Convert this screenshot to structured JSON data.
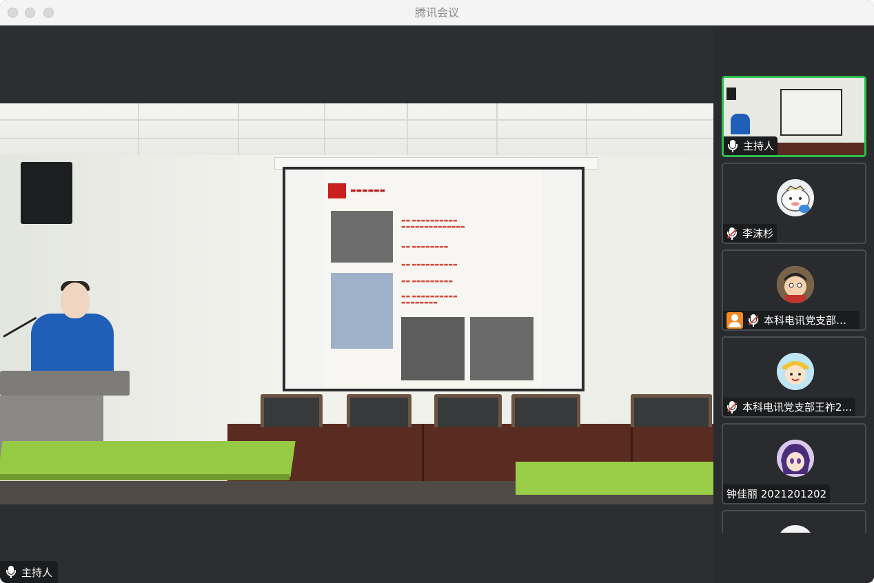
{
  "window": {
    "title": "腾讯会议"
  },
  "main_video": {
    "speaker_label": "主持人"
  },
  "participants": [
    {
      "name": "主持人",
      "muted": false,
      "host": false,
      "type": "camera"
    },
    {
      "name": "李沫杉",
      "muted": true,
      "host": false,
      "type": "avatar"
    },
    {
      "name": "本科电讯党支部杨...",
      "muted": true,
      "host": true,
      "type": "avatar"
    },
    {
      "name": "本科电讯党支部王祚2...",
      "muted": true,
      "host": false,
      "type": "avatar"
    },
    {
      "name": "钟佳丽 2021201202",
      "muted": null,
      "host": false,
      "type": "avatar"
    }
  ],
  "colors": {
    "active_border": "#2bbf4b",
    "host_badge": "#f08a24",
    "mute_slash": "#e04b4b"
  }
}
